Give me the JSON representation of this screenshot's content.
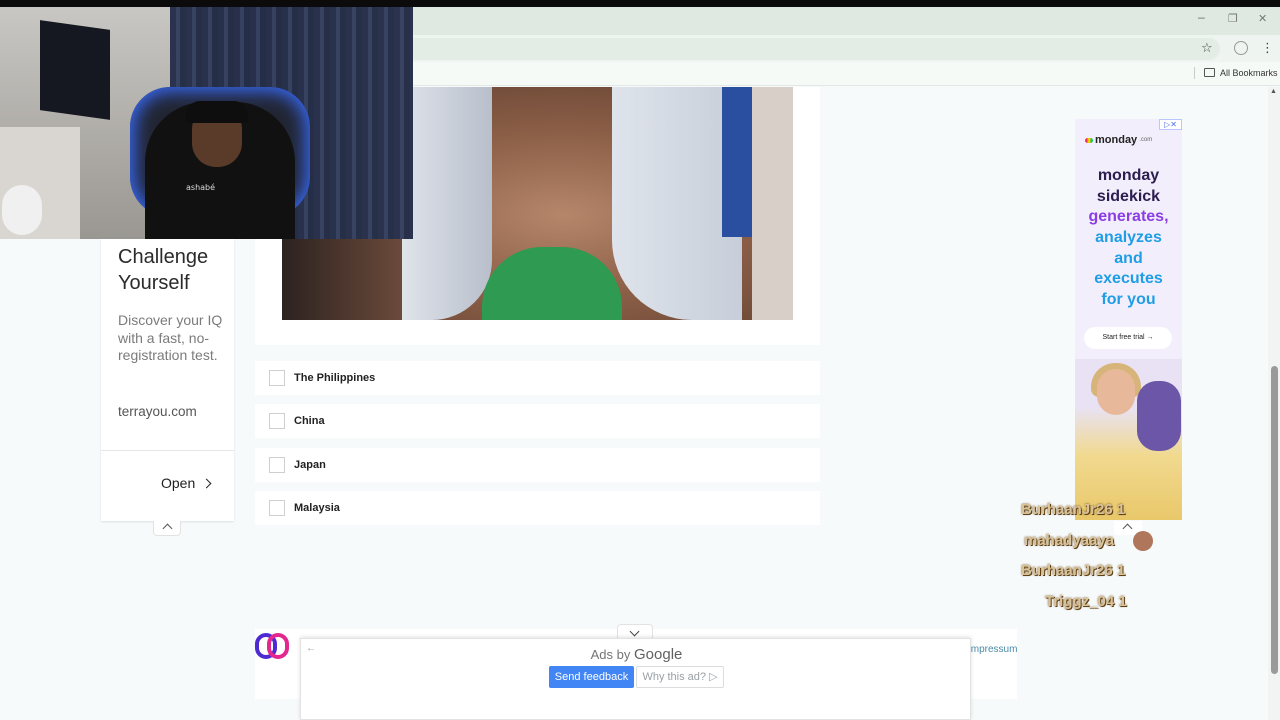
{
  "browser": {
    "window_controls": {
      "minimize": "─",
      "restore": "❐",
      "close": "✕"
    },
    "toolbar": {
      "star_icon": "☆",
      "menu_icon": "⋮"
    },
    "bookmarks_bar": {
      "all_bookmarks_label": "All Bookmarks"
    }
  },
  "webcam": {
    "shirt_text": "ashabé"
  },
  "left_ad": {
    "title": "Challenge Yourself",
    "description": "Discover your IQ with a fast, no-registration test.",
    "domain": "terrayou.com",
    "open_label": "Open"
  },
  "quiz": {
    "options": [
      {
        "label": "The Philippines",
        "checked": false
      },
      {
        "label": "China",
        "checked": false
      },
      {
        "label": "Japan",
        "checked": false
      },
      {
        "label": "Malaysia",
        "checked": false
      }
    ]
  },
  "right_ad": {
    "brand": "monday",
    "brand_suffix": ".com",
    "headline_lines": [
      {
        "text": "monday",
        "color": "#2b1d4f"
      },
      {
        "text": "sidekick",
        "color": "#2b1d4f"
      },
      {
        "text": "generates,",
        "color": "#8a3ee6"
      },
      {
        "text": "analyzes",
        "color": "#1f9ee6"
      },
      {
        "text": "and",
        "color": "#1f9ee6"
      },
      {
        "text": "executes",
        "color": "#1f9ee6"
      },
      {
        "text": "for you",
        "color": "#1f9ee6"
      }
    ],
    "cta_label": "Start free trial →",
    "adchoices_label": "▷✕"
  },
  "chat": [
    {
      "user": "BurhaanJr26",
      "count": "1"
    },
    {
      "user": "mahadyaaya",
      "count": ""
    },
    {
      "user": "BurhaanJr26",
      "count": "1"
    },
    {
      "user": "Triggz_04",
      "count": "1"
    }
  ],
  "footer": {
    "impressum_label": "Impressum"
  },
  "google_ad": {
    "back_icon": "←",
    "ads_by": "Ads by",
    "google": "Google",
    "send_feedback_label": "Send feedback",
    "why_this_ad_label": "Why this ad? ▷"
  },
  "colors": {
    "chrome_frame": "#dfe9e2",
    "google_blue": "#4285f4",
    "footer_logo_purple": "#4d2ad1",
    "footer_logo_pink": "#e4268f"
  }
}
